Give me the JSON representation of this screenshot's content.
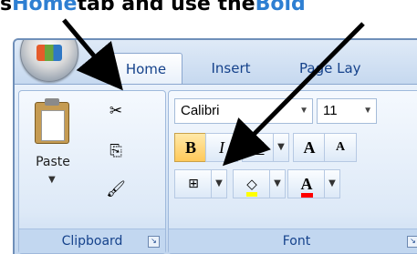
{
  "caption": {
    "prefix": "s ",
    "home": "Home",
    "middle": " tab and use the ",
    "bold": "Bold"
  },
  "tabs": [
    {
      "label": "Home",
      "active": true
    },
    {
      "label": "Insert",
      "active": false
    },
    {
      "label": "Page Lay",
      "active": false
    }
  ],
  "clipboard": {
    "paste_label": "Paste",
    "group_label": "Clipboard"
  },
  "font": {
    "font_name": "Calibri",
    "font_size": "11",
    "bold": "B",
    "italic": "I",
    "underline": "U",
    "grow": "A",
    "shrink": "A",
    "font_color": "A",
    "group_label": "Font"
  },
  "colors": {
    "caption_highlight": "#2e7fd2",
    "tab_text": "#15428b",
    "highlight_fill": "#ffff00",
    "font_color_fill": "#ff0000",
    "bold_highlight": "#ffc95a"
  },
  "icons": [
    "office-button-icon",
    "cut-icon",
    "copy-icon",
    "format-painter-icon",
    "borders-icon",
    "fill-color-icon",
    "launcher-icon"
  ]
}
